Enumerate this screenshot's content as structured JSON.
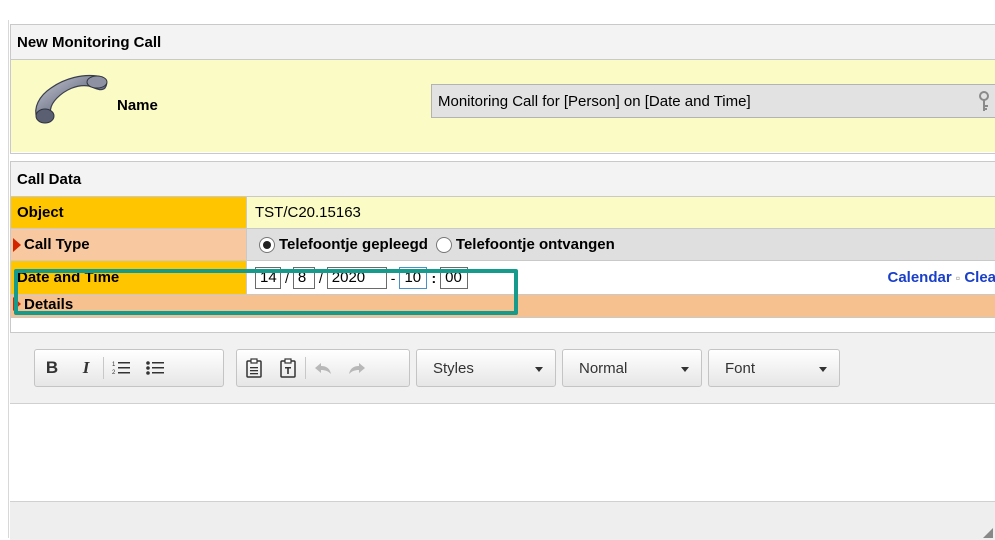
{
  "header": {
    "title": "New Monitoring Call"
  },
  "name_row": {
    "label": "Name",
    "value": "Monitoring Call for [Person] on [Date and Time]"
  },
  "call_data": {
    "title": "Call Data",
    "object": {
      "label": "Object",
      "value": "TST/C20.15163"
    },
    "call_type": {
      "label": "Call Type",
      "options": [
        "Telefoontje gepleegd",
        "Telefoontje ontvangen"
      ],
      "selected": "Telefoontje gepleegd"
    },
    "date_time": {
      "label": "Date and Time",
      "day": "14",
      "month": "8",
      "year": "2020",
      "hour": "10",
      "minute": "00",
      "sep_slash": "/",
      "sep_dash": "-",
      "sep_colon": ":",
      "calendar_link": "Calendar",
      "clear_link": "Clea",
      "link_sep": "▫"
    },
    "details": {
      "label": "Details"
    }
  },
  "editor": {
    "bold": "B",
    "italic": "I",
    "styles": "Styles",
    "format": "Normal",
    "font": "Font"
  },
  "colors": {
    "label_yellow": "#ffc600",
    "value_yellow": "#fbfbc6",
    "call_type_bg": "#f8c8a0",
    "radio_bg": "#dfdfdf",
    "details_bg": "#f6c08f",
    "highlight": "#159a8c",
    "link_blue": "#1a3fc9"
  }
}
